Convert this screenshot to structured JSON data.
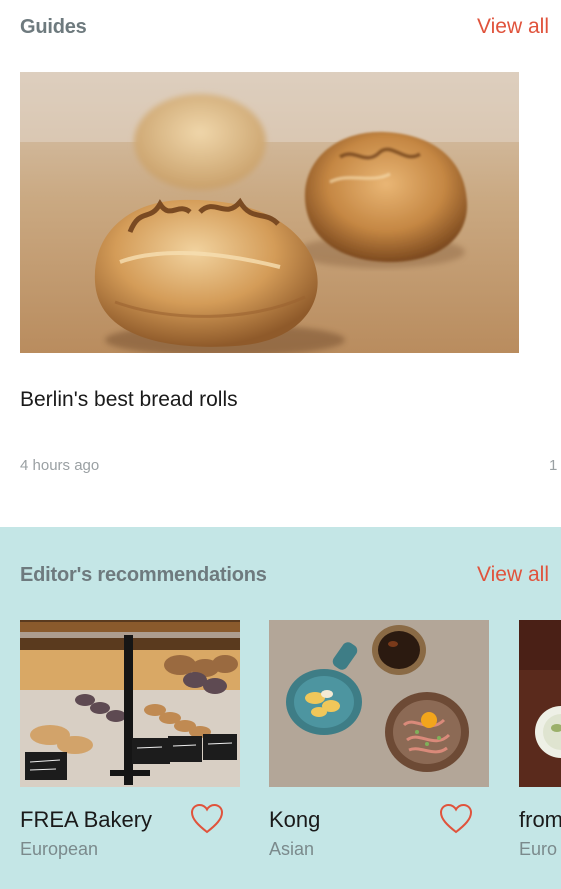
{
  "guides": {
    "title": "Guides",
    "view_all": "View all",
    "featured": {
      "title": "Berlin's best bread rolls",
      "time": "4 hours ago",
      "image": "bread-rolls-photo"
    },
    "next_peek": "1"
  },
  "recommendations": {
    "title": "Editor's recommendations",
    "view_all": "View all",
    "items": [
      {
        "name": "FREA Bakery",
        "cuisine": "European",
        "image": "bakery-display-photo",
        "favorite": false
      },
      {
        "name": "Kong",
        "cuisine": "Asian",
        "image": "asian-dishes-photo",
        "favorite": false
      },
      {
        "name": "from",
        "cuisine": "Euro",
        "image": "partial-restaurant-photo",
        "favorite": false
      }
    ]
  },
  "colors": {
    "accent": "#e0533c",
    "section_title": "#6e7a7e",
    "recs_background": "#c4e6e6",
    "muted_text": "#9aa0a3"
  },
  "icons": [
    "heart-outline-icon"
  ]
}
